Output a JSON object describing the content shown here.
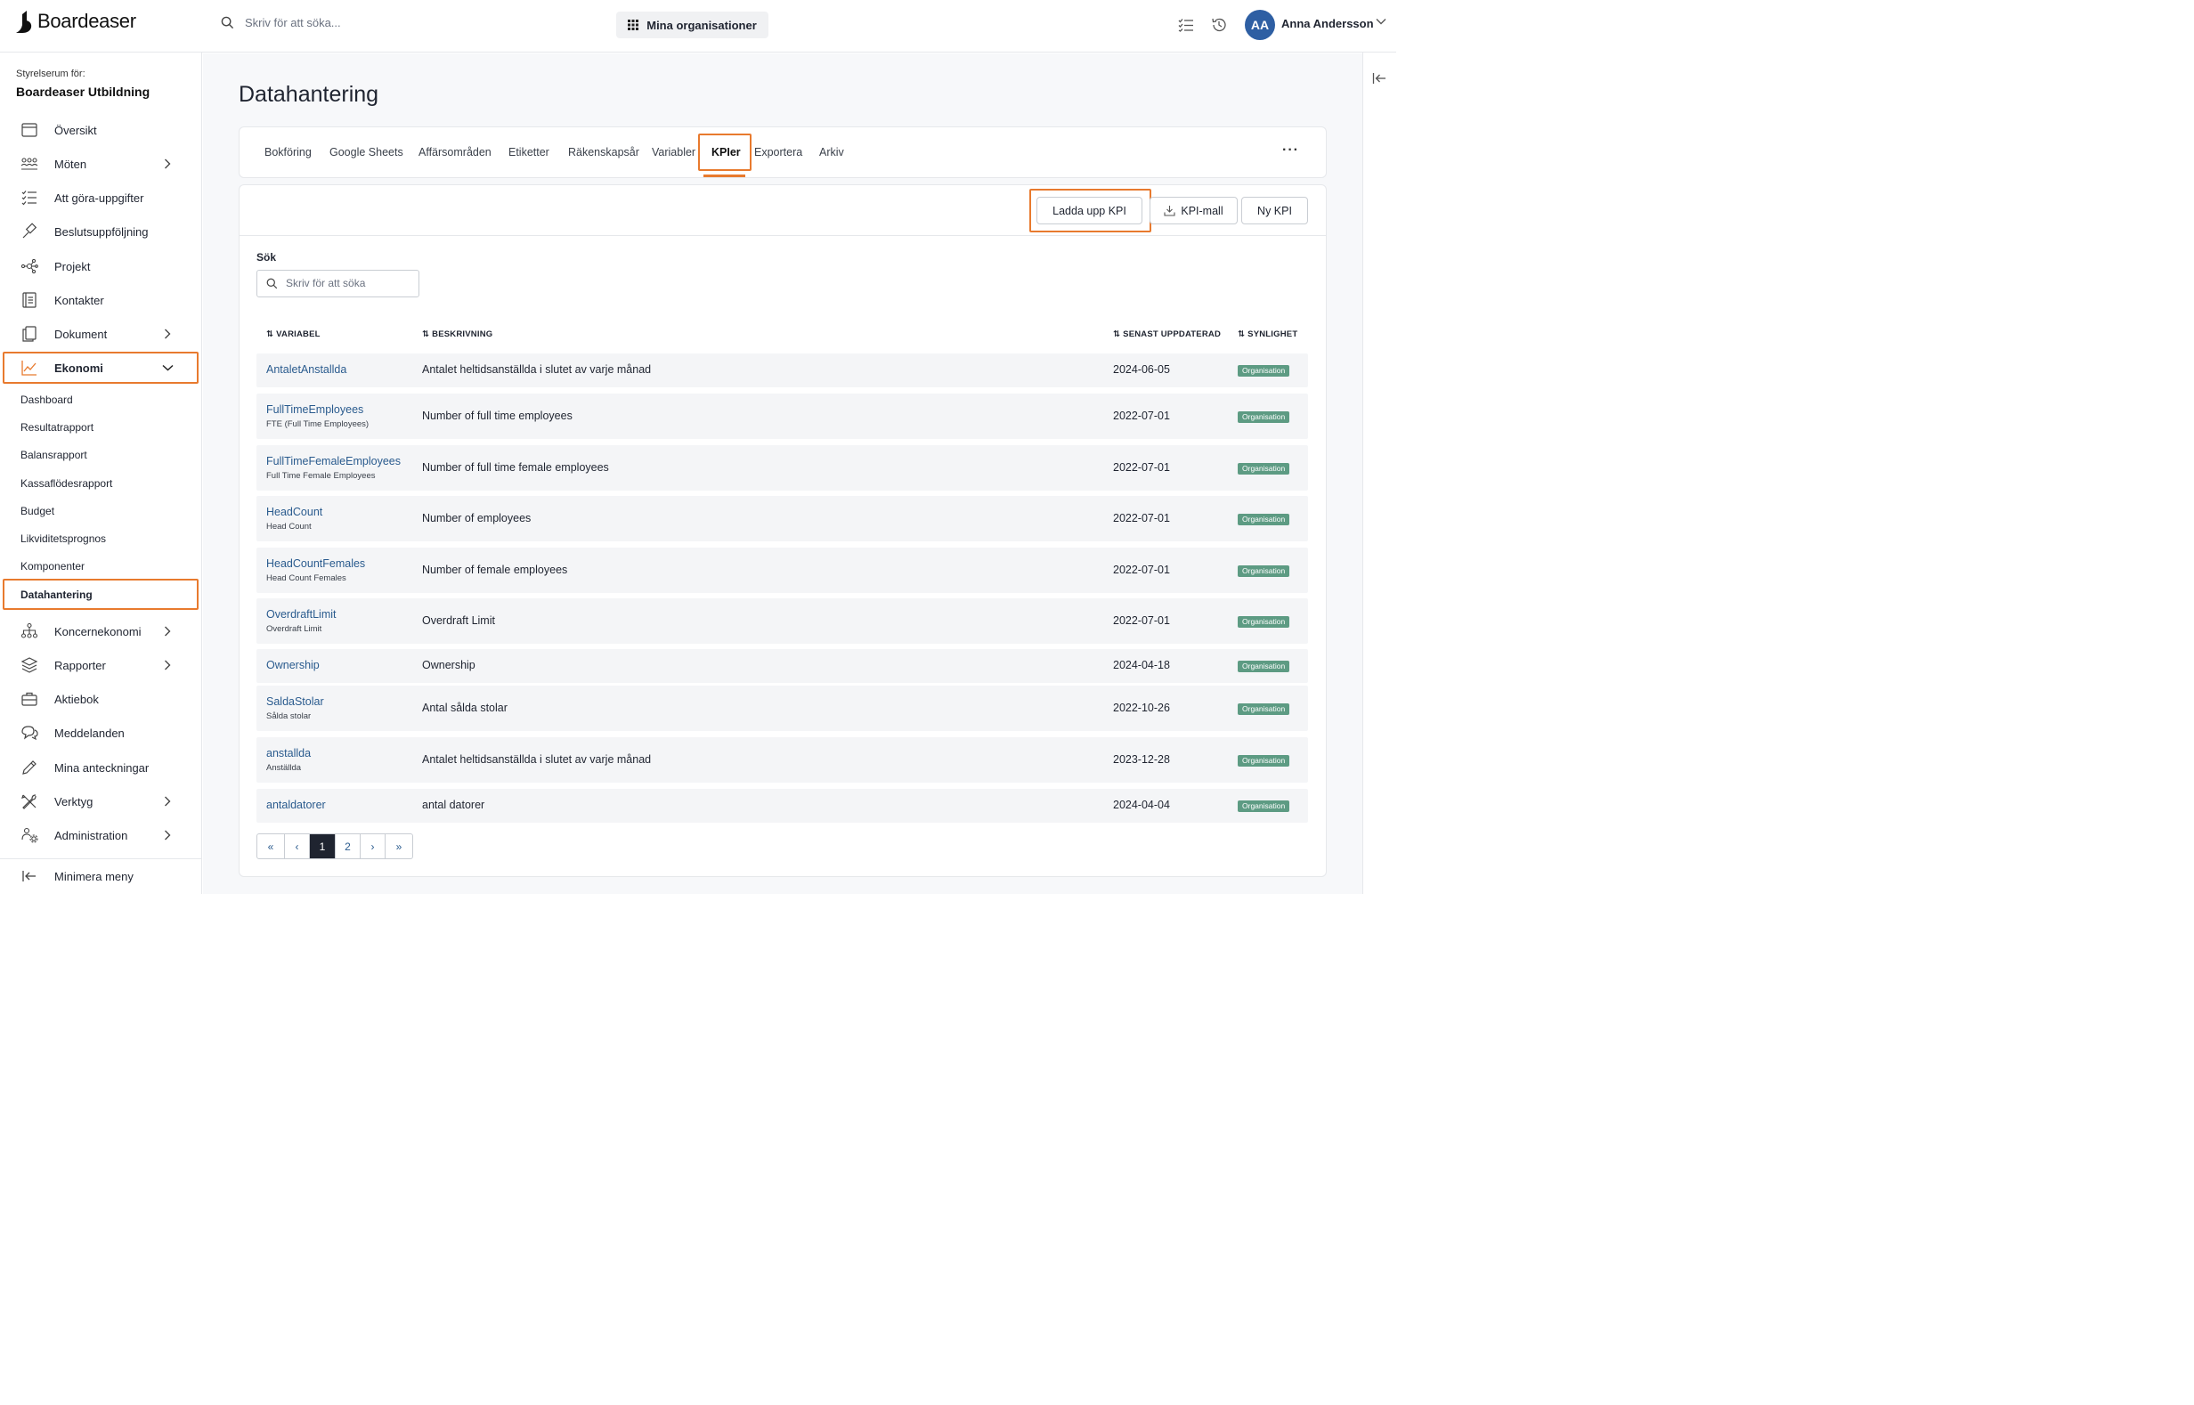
{
  "topbar": {
    "brand": "Boardeaser",
    "search_placeholder": "Skriv för att söka...",
    "org_button": "Mina organisationer",
    "user_initials": "AA",
    "user_name": "Anna Andersson"
  },
  "sidebar": {
    "caption": "Styrelserum för:",
    "org_name": "Boardeaser Utbildning",
    "items": [
      {
        "label": "Översikt",
        "icon": "calendar-icon"
      },
      {
        "label": "Möten",
        "icon": "people-icon"
      },
      {
        "label": "Att göra-uppgifter",
        "icon": "checklist-icon"
      },
      {
        "label": "Beslutsuppföljning",
        "icon": "gavel-icon"
      },
      {
        "label": "Projekt",
        "icon": "network-icon"
      },
      {
        "label": "Kontakter",
        "icon": "contacts-icon"
      },
      {
        "label": "Dokument",
        "icon": "document-icon"
      },
      {
        "label": "Ekonomi",
        "icon": "chart-icon"
      }
    ],
    "ekonomi_sub": [
      "Dashboard",
      "Resultatrapport",
      "Balansrapport",
      "Kassaflödesrapport",
      "Budget",
      "Likviditetsprognos",
      "Komponenter",
      "Datahantering"
    ],
    "items2": [
      {
        "label": "Koncernekonomi",
        "icon": "org-chart-icon"
      },
      {
        "label": "Rapporter",
        "icon": "layers-icon"
      },
      {
        "label": "Aktiebok",
        "icon": "briefcase-icon"
      },
      {
        "label": "Meddelanden",
        "icon": "chat-icon"
      },
      {
        "label": "Mina anteckningar",
        "icon": "pencil-icon"
      },
      {
        "label": "Verktyg",
        "icon": "tools-icon"
      },
      {
        "label": "Administration",
        "icon": "admin-icon"
      }
    ],
    "minimize": "Minimera meny"
  },
  "page": {
    "title": "Datahantering",
    "tabs": [
      "Bokföring",
      "Google Sheets",
      "Affärsområden",
      "Etiketter",
      "Räkenskapsår",
      "Variabler",
      "KPIer",
      "Exportera",
      "Arkiv"
    ],
    "active_tab": "KPIer",
    "more": "···",
    "buttons": {
      "upload": "Ladda upp KPI",
      "template": "KPI-mall",
      "new": "Ny KPI"
    },
    "search_label": "Sök",
    "search_placeholder": "Skriv för att söka"
  },
  "table": {
    "headers": [
      "VARIABEL",
      "BESKRIVNING",
      "SENAST UPPDATERAD",
      "SYNLIGHET"
    ],
    "rows": [
      {
        "variable": "AntaletAnstallda",
        "sub": "",
        "description": "Antalet heltidsanställda i slutet av varje månad",
        "updated": "2024-06-05",
        "visibility": "Organisation"
      },
      {
        "variable": "FullTimeEmployees",
        "sub": "FTE (Full Time Employees)",
        "description": "Number of full time employees",
        "updated": "2022-07-01",
        "visibility": "Organisation"
      },
      {
        "variable": "FullTimeFemaleEmployees",
        "sub": "Full Time Female Employees",
        "description": "Number of full time female employees",
        "updated": "2022-07-01",
        "visibility": "Organisation"
      },
      {
        "variable": "HeadCount",
        "sub": "Head Count",
        "description": "Number of employees",
        "updated": "2022-07-01",
        "visibility": "Organisation"
      },
      {
        "variable": "HeadCountFemales",
        "sub": "Head Count Females",
        "description": "Number of female employees",
        "updated": "2022-07-01",
        "visibility": "Organisation"
      },
      {
        "variable": "OverdraftLimit",
        "sub": "Overdraft Limit",
        "description": "Overdraft Limit",
        "updated": "2022-07-01",
        "visibility": "Organisation"
      },
      {
        "variable": "Ownership",
        "sub": "",
        "description": "Ownership",
        "updated": "2024-04-18",
        "visibility": "Organisation"
      },
      {
        "variable": "SaldaStolar",
        "sub": "Sålda stolar",
        "description": "Antal sålda stolar",
        "updated": "2022-10-26",
        "visibility": "Organisation"
      },
      {
        "variable": "anstallda",
        "sub": "Anställda",
        "description": "Antalet heltidsanställda i slutet av varje månad",
        "updated": "2023-12-28",
        "visibility": "Organisation"
      },
      {
        "variable": "antaldatorer",
        "sub": "",
        "description": "antal datorer",
        "updated": "2024-04-04",
        "visibility": "Organisation"
      }
    ]
  },
  "pagination": {
    "first": "«",
    "prev": "‹",
    "pages": [
      "1",
      "2"
    ],
    "current": "1",
    "next": "›",
    "last": "»"
  },
  "colors": {
    "accent": "#e87a2e",
    "link": "#2a5b8e",
    "badge": "#5d9b83",
    "avatar": "#2e5fa3"
  }
}
